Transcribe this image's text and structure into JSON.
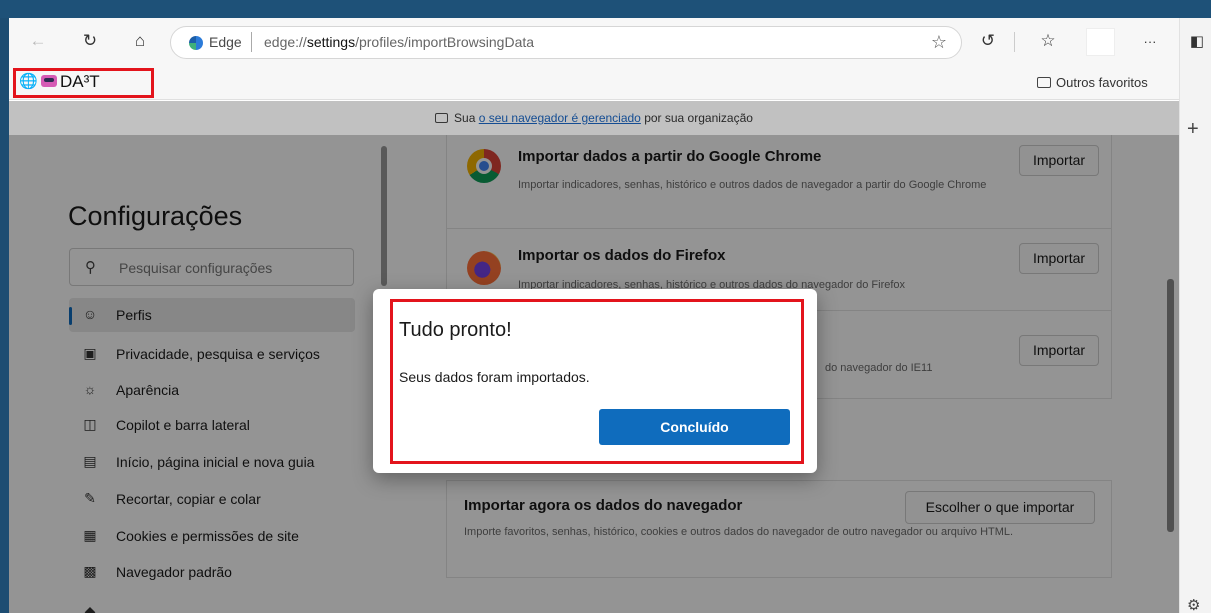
{
  "toolbar": {
    "back_icon": "arrow-left-icon",
    "refresh_icon": "refresh-icon",
    "home_icon": "home-icon",
    "brand": "Edge",
    "url_prefix": "edge://",
    "url_bold": "settings",
    "url_rest": "/profiles/importBrowsingData",
    "favorite_star_icon": "star-icon",
    "more_label": "···"
  },
  "favorites_bar": {
    "item_label": "DA³T",
    "other_favorites": "Outros favoritos"
  },
  "managed_banner": {
    "prefix": "Sua ",
    "link": "o seu navegador é gerenciado",
    "suffix": " por sua organização"
  },
  "sidebar": {
    "title": "Configurações",
    "search_placeholder": "Pesquisar configurações",
    "items": [
      {
        "label": "Perfis",
        "icon": "profile-icon",
        "active": true
      },
      {
        "label": "Privacidade, pesquisa e serviços",
        "icon": "lock-icon"
      },
      {
        "label": "Aparência",
        "icon": "appearance-icon"
      },
      {
        "label": "Copilot e barra lateral",
        "icon": "sidebar-icon"
      },
      {
        "label": "Início, página inicial e nova guia",
        "icon": "home-page-icon"
      },
      {
        "label": "Recortar, copiar e colar",
        "icon": "clipboard-icon"
      },
      {
        "label": "Cookies e permissões de site",
        "icon": "cookies-icon"
      },
      {
        "label": "Navegador padrão",
        "icon": "default-browser-icon"
      }
    ]
  },
  "import_rows": [
    {
      "title": "Importar dados a partir do Google Chrome",
      "desc": "Importar indicadores, senhas, histórico e outros dados de navegador a partir do Google Chrome",
      "button": "Importar"
    },
    {
      "title": "Importar os dados do Firefox",
      "desc": "Importar indicadores, senhas, histórico e outros dados do navegador do Firefox",
      "button": "Importar"
    },
    {
      "title": "",
      "desc": "do navegador do IE11",
      "button": "Importar"
    }
  ],
  "import_now": {
    "title": "Importar agora os dados do navegador",
    "desc": "Importe favoritos, senhas, histórico, cookies e outros dados do navegador de outro navegador ou arquivo HTML.",
    "button": "Escolher o que importar"
  },
  "dialog": {
    "title": "Tudo pronto!",
    "message": "Seus dados foram importados.",
    "button": "Concluído"
  },
  "colors": {
    "accent": "#0f6cbd",
    "highlight": "#e3141c"
  }
}
